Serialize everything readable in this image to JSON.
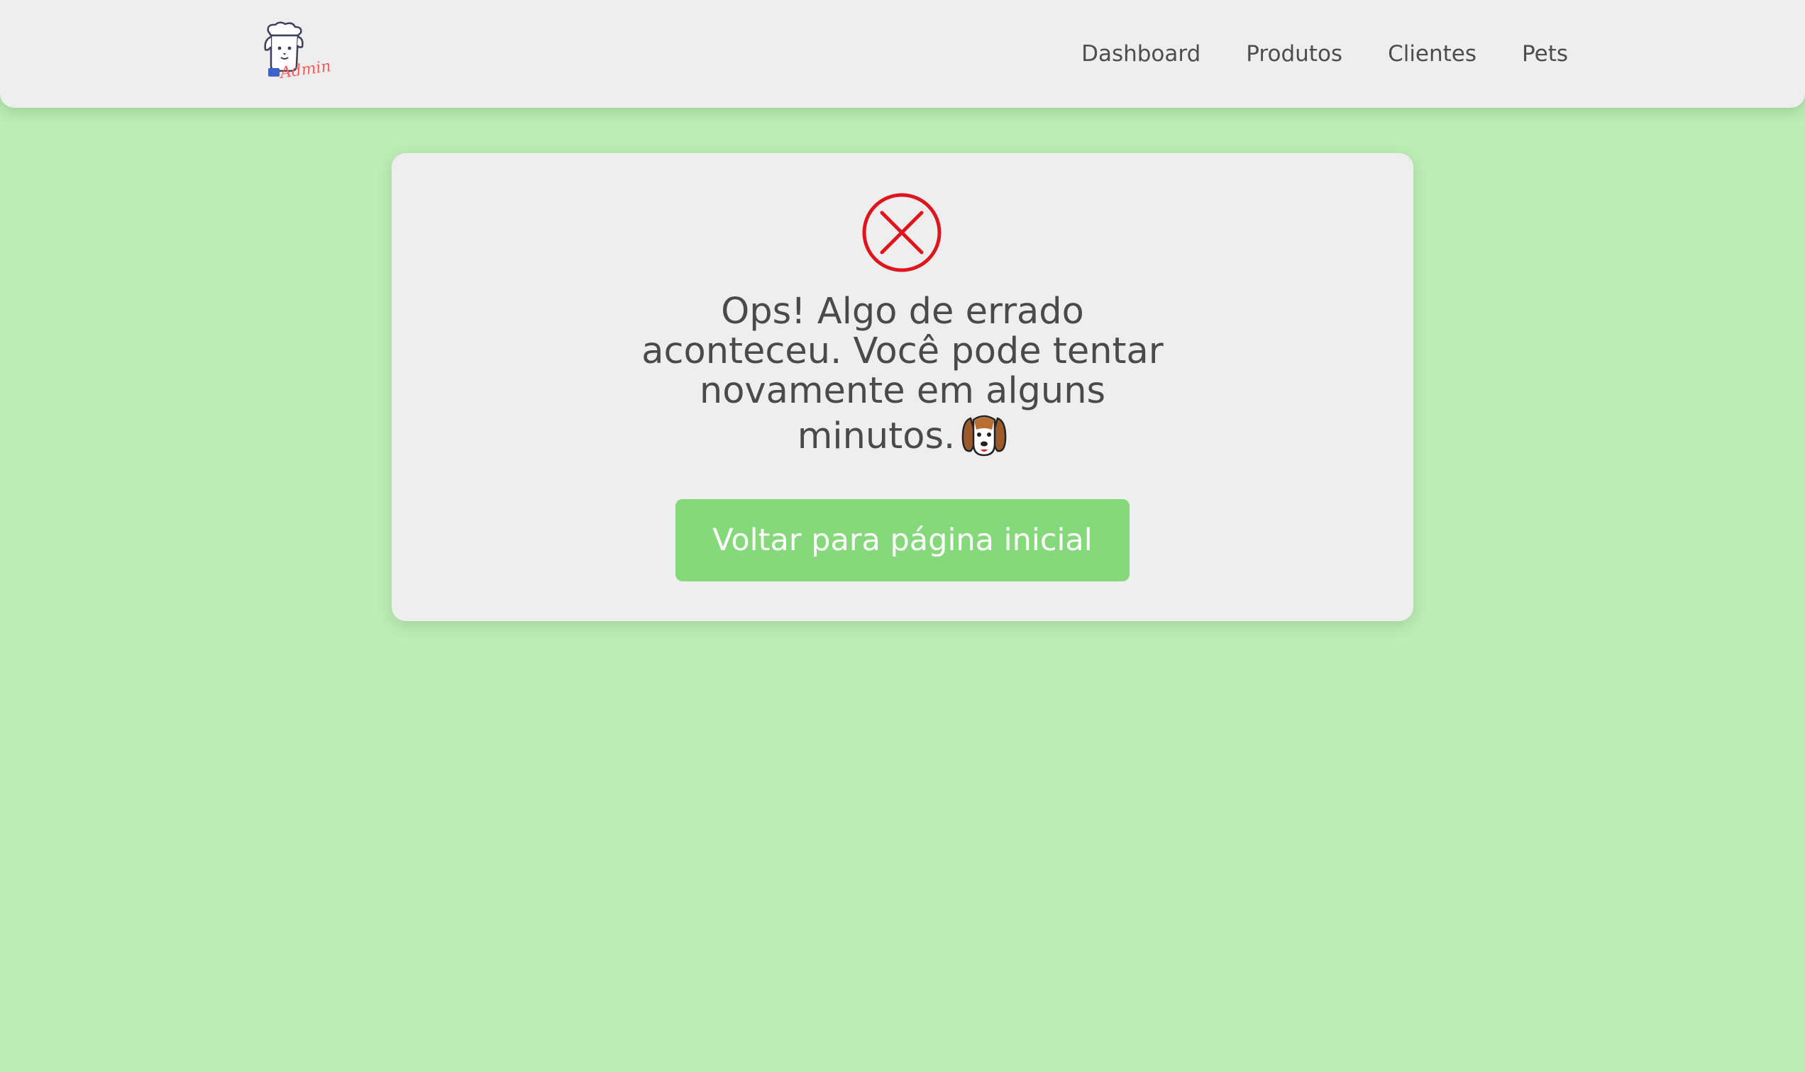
{
  "header": {
    "logo": {
      "icon": "dog-chef-logo-icon",
      "text": "Admin",
      "text_color": "#ff5a5a"
    },
    "nav": [
      {
        "label": "Dashboard"
      },
      {
        "label": "Produtos"
      },
      {
        "label": "Clientes"
      },
      {
        "label": "Pets"
      }
    ]
  },
  "error_card": {
    "icon": "error-x-circle-icon",
    "icon_color": "#e0141c",
    "message": "Ops! Algo de errado aconteceu. Você pode tentar novamente em alguns minutos.",
    "emoji": "dog-face-icon",
    "button_label": "Voltar para página inicial",
    "button_color": "#86d97a"
  },
  "colors": {
    "background": "#beedb7",
    "surface": "#eeeeee",
    "text": "#4a4a4a"
  }
}
